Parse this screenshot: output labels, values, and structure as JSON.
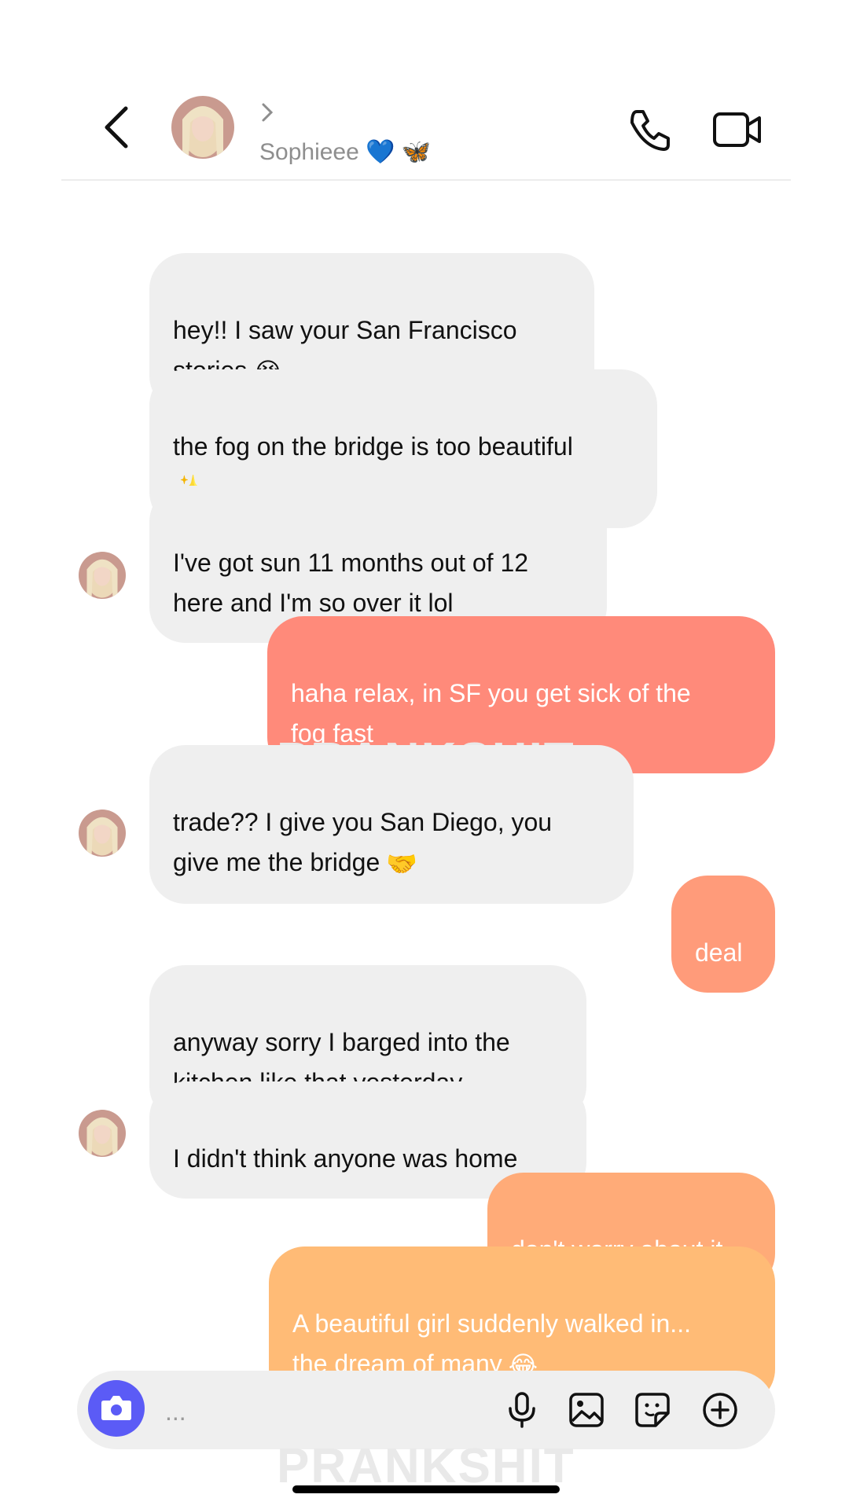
{
  "header": {
    "contact_name": "Sophieee",
    "name_emojis": "💙 🦋"
  },
  "messages": [
    {
      "side": "in",
      "text": "hey!! I saw your San Francisco\nstories",
      "emoji": "😭"
    },
    {
      "side": "in",
      "text": "the fog on the bridge is too beautiful\n",
      "emoji": "✨"
    },
    {
      "side": "in",
      "text": "I've got sun 11 months out of 12\nhere and I'm so over it lol",
      "emoji": ""
    },
    {
      "side": "out",
      "text": "haha relax, in SF you get sick of the\nfog fast",
      "emoji": "",
      "color": "#ff8a7a"
    },
    {
      "side": "in",
      "text": "trade?? I give you San Diego, you\ngive me the bridge",
      "emoji": "🤝"
    },
    {
      "side": "out",
      "text": "deal",
      "emoji": "",
      "color": "#ff9b7a"
    },
    {
      "side": "in",
      "text": "anyway sorry I barged into the\nkitchen like that yesterday",
      "emoji": ""
    },
    {
      "side": "in",
      "text": "I didn't think anyone was home",
      "emoji": ""
    },
    {
      "side": "out",
      "text": "don't worry about it",
      "emoji": "",
      "color": "#ffab78"
    },
    {
      "side": "out",
      "text": "A beautiful girl suddenly walked in...\nthe dream of many",
      "emoji": "😂",
      "color": "#ffbb76"
    }
  ],
  "watermark": "PRANKSHIT",
  "composer": {
    "placeholder": "..."
  },
  "icons": {
    "back": "chevron-left-icon",
    "call": "phone-icon",
    "video": "video-camera-icon",
    "camera": "camera-icon",
    "mic": "microphone-icon",
    "gallery": "image-icon",
    "sticker": "sticker-icon",
    "add": "plus-circle-icon"
  }
}
